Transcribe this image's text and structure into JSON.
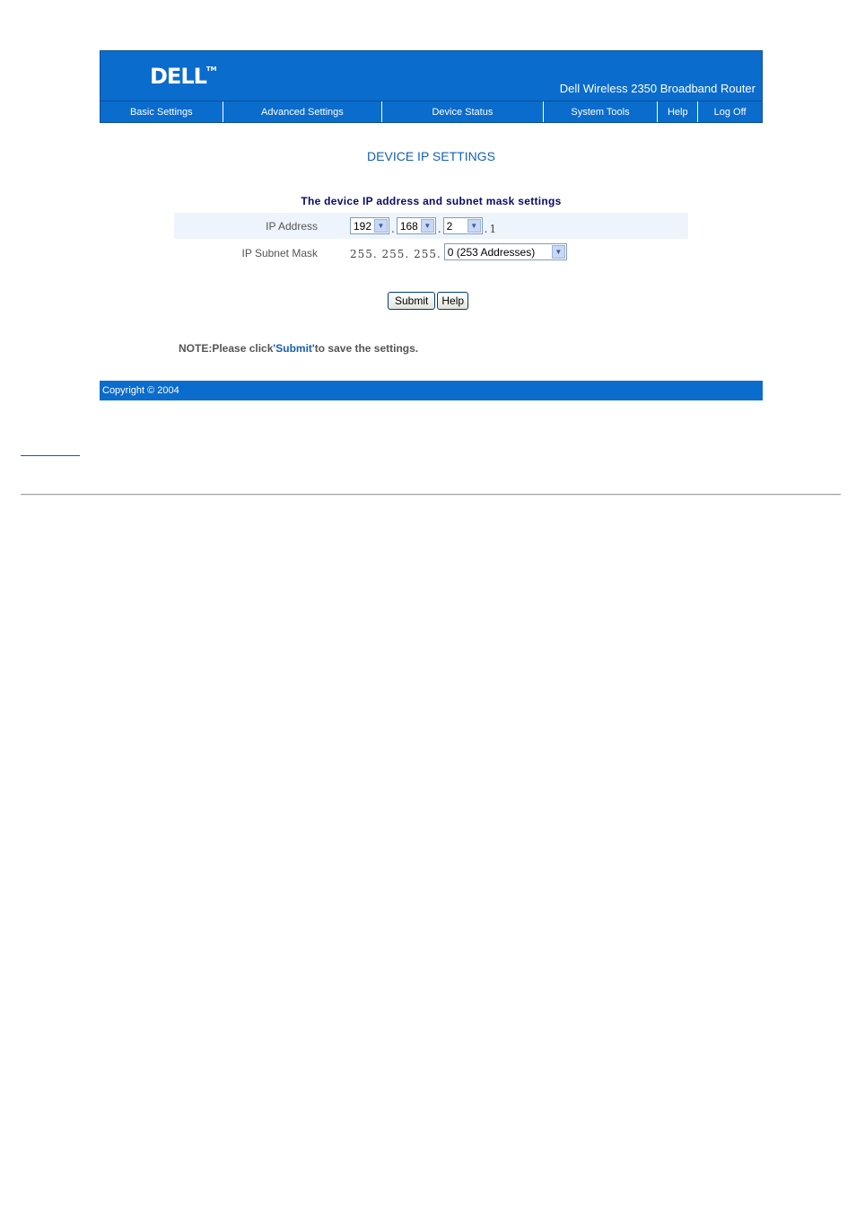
{
  "header": {
    "logo_text": "DELL",
    "logo_tm": "TM",
    "product_name": "Dell Wireless 2350 Broadband Router"
  },
  "nav": [
    {
      "label": "Basic Settings",
      "name": "nav-basic-settings"
    },
    {
      "label": "Advanced Settings",
      "name": "nav-advanced-settings"
    },
    {
      "label": "Device Status",
      "name": "nav-device-status"
    },
    {
      "label": "System Tools",
      "name": "nav-system-tools"
    },
    {
      "label": "Help",
      "name": "nav-help"
    },
    {
      "label": "Log Off",
      "name": "nav-log-off"
    }
  ],
  "page": {
    "title": "DEVICE IP SETTINGS",
    "section_title": "The device IP address and subnet mask settings"
  },
  "ip_address": {
    "label": "IP Address",
    "octet1": "192",
    "octet2": "168",
    "octet3": "2",
    "octet4": "1",
    "separator": "."
  },
  "subnet_mask": {
    "label": "IP Subnet Mask",
    "prefix": "255. 255. 255.",
    "selected": "0 (253 Addresses)"
  },
  "buttons": {
    "submit": "Submit",
    "help": "Help"
  },
  "note": {
    "prefix": "NOTE:Please click",
    "link": "'Submit'",
    "suffix": "to save the settings."
  },
  "footer": {
    "copyright": "Copyright © 2004"
  }
}
